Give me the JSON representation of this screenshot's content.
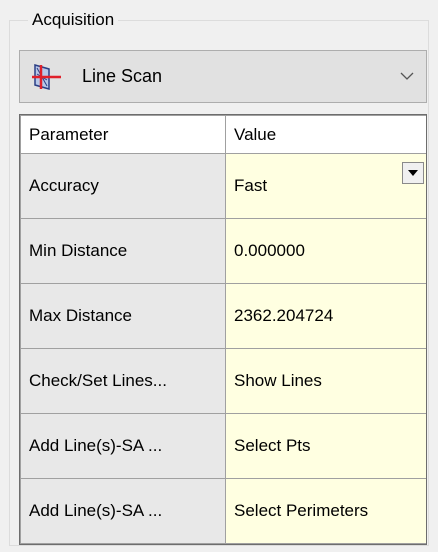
{
  "group": {
    "title": "Acquisition"
  },
  "combo": {
    "selected": "Line Scan",
    "icon": "line-scan-icon"
  },
  "grid": {
    "headers": {
      "param": "Parameter",
      "value": "Value"
    },
    "rows": [
      {
        "param": "Accuracy",
        "value": "Fast",
        "has_dropdown": true
      },
      {
        "param": "Min Distance",
        "value": "0.000000"
      },
      {
        "param": "Max Distance",
        "value": "2362.204724"
      },
      {
        "param": "Check/Set Lines...",
        "value": "Show Lines"
      },
      {
        "param": "Add Line(s)-SA ...",
        "value": "Select Pts"
      },
      {
        "param": "Add Line(s)-SA ...",
        "value": "Select Perimeters"
      }
    ]
  },
  "colors": {
    "value_bg": "#ffffe1",
    "param_bg": "#e8e8e8",
    "icon_red": "#e0202a"
  }
}
